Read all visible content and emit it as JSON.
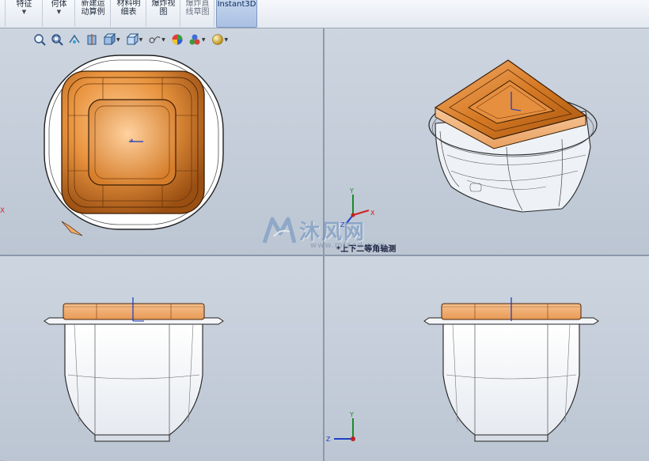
{
  "ribbon": {
    "buttons": [
      {
        "line1": "特征",
        "line2": "",
        "dropdown": true
      },
      {
        "line1": "何体",
        "line2": "",
        "dropdown": true
      },
      {
        "line1": "新建运",
        "line2": "动算例",
        "dropdown": false
      },
      {
        "line1": "材料明",
        "line2": "细表",
        "dropdown": false
      },
      {
        "line1": "爆炸视",
        "line2": "图",
        "dropdown": false
      },
      {
        "line1": "爆炸直",
        "line2": "线草图",
        "dropdown": false
      },
      {
        "line1": "Instant3D",
        "line2": "",
        "dropdown": false
      }
    ]
  },
  "hud_toolbar": {
    "items": [
      "zoom-to-fit-icon",
      "zoom-to-area-icon",
      "previous-view-icon",
      "section-view-icon",
      "view-orientation-icon",
      "display-style-icon",
      "hide-show-items-icon",
      "edit-appearance-icon",
      "apply-scene-icon",
      "view-settings-icon"
    ]
  },
  "viewports": {
    "isometric_label": "*上下二等角轴测"
  },
  "triad": {
    "y": "Y",
    "z": "Z",
    "x": "X"
  },
  "watermark": {
    "brand": "沐风网",
    "url": "www.mfcad.com"
  },
  "colors": {
    "lid_orange": "#c8711f",
    "lid_light": "#f2b27a",
    "viewport_bg": "#c9d2de",
    "active_button": "#b4c8e8"
  }
}
